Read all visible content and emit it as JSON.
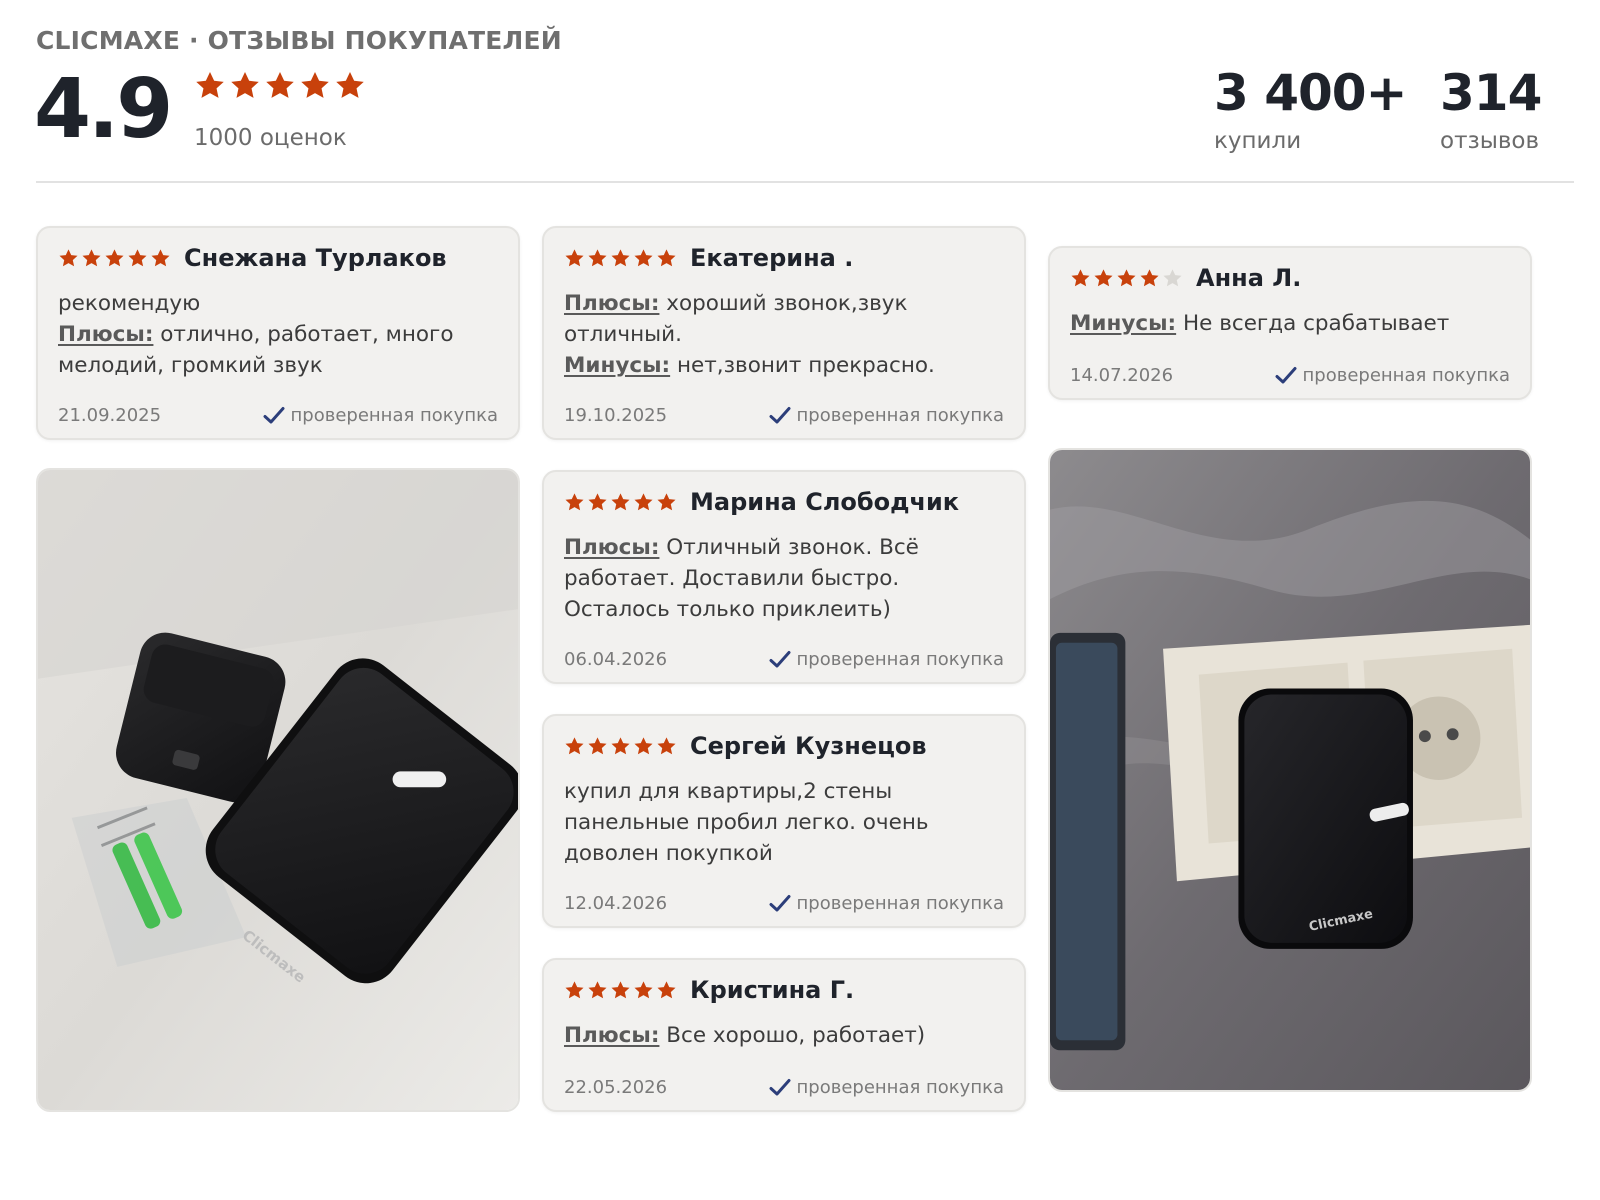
{
  "header": {
    "brand": "CLICMAXE · ОТЗЫВЫ ПОКУПАТЕЛЕЙ",
    "rating": "4.9",
    "rating_stars": 5,
    "ratings_count": "1000 оценок",
    "bought_num": "3 400+",
    "bought_label": "купили",
    "reviews_num": "314",
    "reviews_label": "отзывов"
  },
  "colors": {
    "star": "#c8410b",
    "star_empty": "#d9d7d3",
    "check": "#2c3e7a",
    "card_bg": "#f2f1ef"
  },
  "reviews": [
    {
      "author": "Снежана Турлаков",
      "stars": 5,
      "text": "рекомендую",
      "pros_label": "Плюсы:",
      "pros": "отлично, работает, много мелодий, громкий звук",
      "date": "21.09.2025",
      "verified": "проверенная покупка"
    },
    {
      "author": "Екатерина .",
      "stars": 5,
      "pros_label": "Плюсы:",
      "pros": "хороший звонок,звук отличный.",
      "cons_label": "Минусы:",
      "cons": "нет,звонит прекрасно.",
      "date": "19.10.2025",
      "verified": "проверенная покупка"
    },
    {
      "author": "Анна Л.",
      "stars": 4,
      "cons_label": "Минусы:",
      "cons": "Не всегда срабатывает",
      "date": "14.07.2026",
      "verified": "проверенная покупка"
    },
    {
      "author": "Марина Слободчик",
      "stars": 5,
      "pros_label": "Плюсы:",
      "pros": "Отличный звонок. Всё работает. Доставили быстро. Осталось только приклеить)",
      "date": "06.04.2026",
      "verified": "проверенная покупка"
    },
    {
      "author": "Сергей Кузнецов",
      "stars": 5,
      "text": "купил для квартиры,2 стены панельные пробил легко. очень доволен покупкой",
      "date": "12.04.2026",
      "verified": "проверенная покупка"
    },
    {
      "author": "Кристина Г.",
      "stars": 5,
      "pros_label": "Плюсы:",
      "pros": "Все хорошо, работает)",
      "date": "22.05.2026",
      "verified": "проверенная покупка"
    }
  ],
  "photos": {
    "photo1_brand": "Clicmaxe",
    "photo2_brand": "Clicmaxe"
  }
}
